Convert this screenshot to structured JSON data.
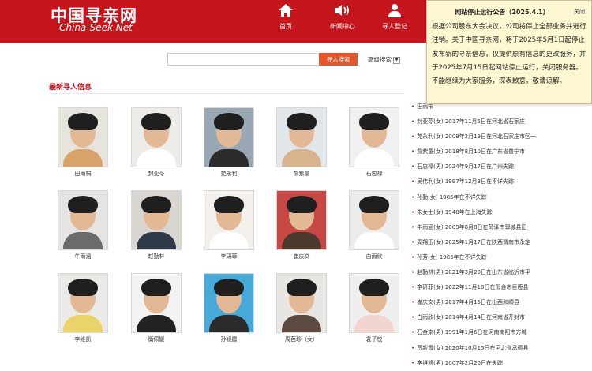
{
  "header": {
    "logo_cn": "中国寻亲网",
    "logo_en": "China-Seek.Net",
    "nav": [
      {
        "label": "首页",
        "icon": "home-icon"
      },
      {
        "label": "新闻中心",
        "icon": "speaker-icon"
      },
      {
        "label": "寻人登记",
        "icon": "person-icon"
      }
    ]
  },
  "colors": {
    "brand": "#c4161c",
    "search_button": "#e4572e",
    "popup_bg": "#fdf8d2"
  },
  "search": {
    "placeholder": "",
    "button_label": "寻人搜索",
    "advanced_label": "高级搜索"
  },
  "section": {
    "title": "最新寻人信息"
  },
  "people": [
    {
      "name": "田雨桐"
    },
    {
      "name": "封亚苓"
    },
    {
      "name": "苑永利"
    },
    {
      "name": "詹紫童"
    },
    {
      "name": "石忠禄"
    },
    {
      "name": "牛雨涵"
    },
    {
      "name": "赵勤林"
    },
    {
      "name": "李研菲"
    },
    {
      "name": "崔庆文"
    },
    {
      "name": "白雨欣"
    },
    {
      "name": "李维凯"
    },
    {
      "name": "衡佩媛"
    },
    {
      "name": "孙镜霞"
    },
    {
      "name": "周芭珍（女）"
    },
    {
      "name": "袁子悦"
    }
  ],
  "news": [
    "田雨桐",
    "封亚苓(女) 2017年11月5日在河北省石家庄",
    "苑永利(女) 2009年2月19日在河北石家庄市区一",
    "詹紫童(女) 2018年8月10日在广东省普宁市",
    "石忠禄(男) 2024年9月17日在广州失踪",
    "吴伟利(女) 1997年12月3日在不详失踪",
    "孙勤(女) 1985年在不详失踪",
    "朱女士(女) 1940年在上海失踪",
    "牛雨涵(女) 2009年8月8日在菏泽市郓城县田",
    "周翔玉(女) 2025年1月17日在陕西渭南市永定",
    "孙芳(女) 1985年在不详失踪",
    "赵勤林(男) 2021年3月20日在山东省临沂市平",
    "李研菲(女) 2022年11月10日在邢台市巨鹿县",
    "崔庆文(男) 2017年4月15日在山西和顺县",
    "白雨欣(女) 2014年4月14日在河南省开封市",
    "石金来(男) 1991年1月6日在河南南阳市方城",
    "贾新霞(女) 2020年10月15日在河北省承德县",
    "李维凯(男) 2007年2月20日在失踪"
  ],
  "popup": {
    "title": "网站停止运行公告（2025.4.1）",
    "close_label": "关闭",
    "body": "根据公司股东大会决议，公司将停止全部业务并进行注销。关于中国寻亲网，将于2025年5月1日起停止发布新的寻亲信息，仅提供原有信息的更改服务，并于2025年7月15日起网站停止运行，关闭服务器。不能继续为大家服务，深表歉意，敬请谅解。"
  }
}
